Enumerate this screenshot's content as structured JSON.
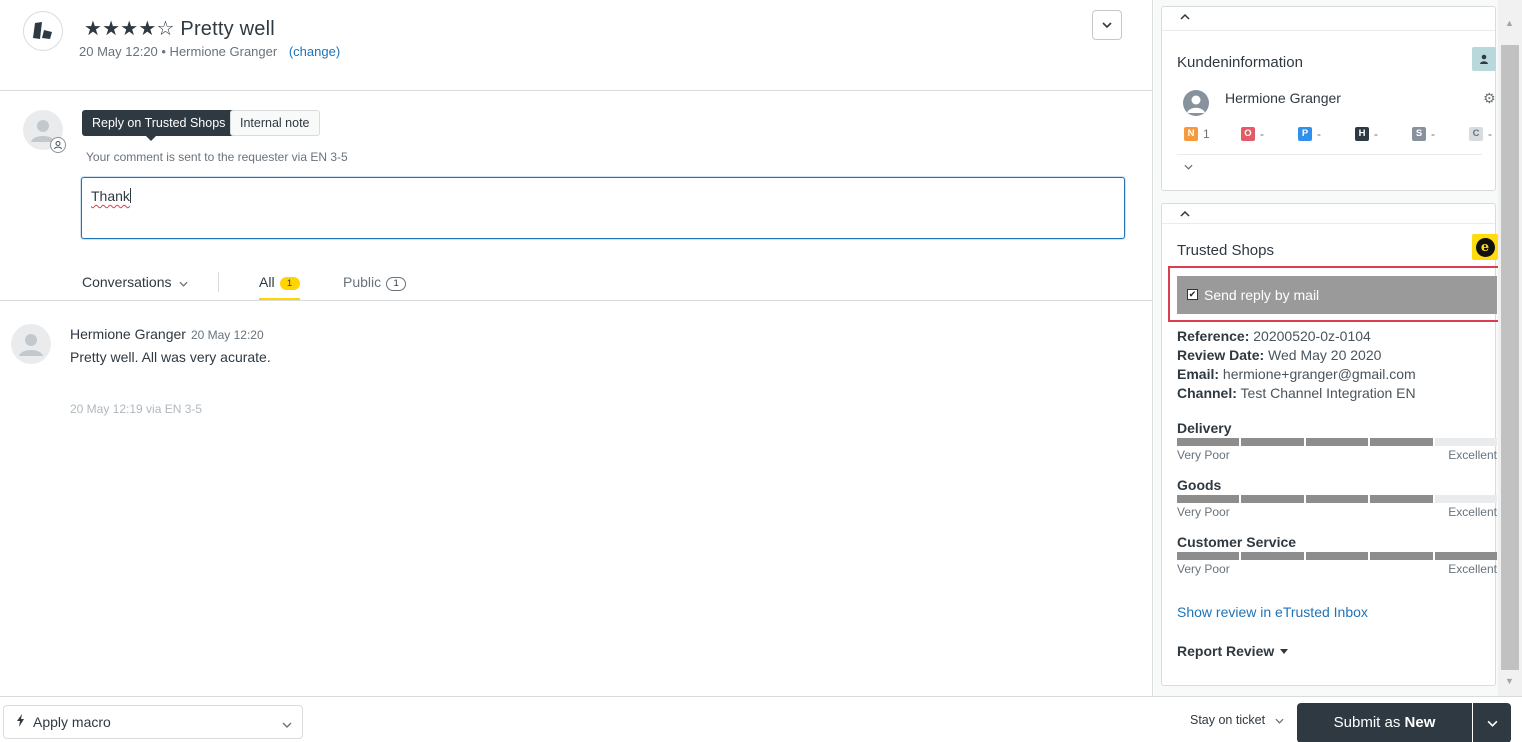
{
  "header": {
    "title": "★★★★☆ Pretty well",
    "meta": "20 May 12:20 • Hermione Granger",
    "change_link": "(change)"
  },
  "composer": {
    "tab_reply": "Reply on Trusted Shops",
    "tab_note": "Internal note",
    "hint": "Your comment is sent to the requester via EN 3-5",
    "text": "Thank"
  },
  "filters": {
    "conversations": "Conversations",
    "all": "All",
    "all_count": "1",
    "public": "Public",
    "public_count": "1"
  },
  "comment": {
    "author": "Hermione Granger",
    "time": "20 May 12:20",
    "body": "Pretty well. All was very acurate.",
    "via": "20 May 12:19 via EN 3-5"
  },
  "customer_info": {
    "title": "Kundeninformation",
    "name": "Hermione Granger",
    "stats": [
      {
        "tag": "N",
        "value": "1",
        "color": "#f79a3e"
      },
      {
        "tag": "O",
        "value": "-",
        "color": "#e35b66"
      },
      {
        "tag": "P",
        "value": "-",
        "color": "#3091ec"
      },
      {
        "tag": "H",
        "value": "-",
        "color": "#2f3941"
      },
      {
        "tag": "S",
        "value": "-",
        "color": "#87929d"
      },
      {
        "tag": "C",
        "value": "-",
        "color": "#d8dcde"
      }
    ]
  },
  "trusted_shops": {
    "title": "Trusted Shops",
    "send_reply_label": "Send reply by mail",
    "send_reply_checked": true,
    "fields": [
      {
        "label": "Reference:",
        "value": "20200520-0z-0104"
      },
      {
        "label": "Review Date:",
        "value": "Wed May 20 2020"
      },
      {
        "label": "Email:",
        "value": "hermione+granger@gmail.com"
      },
      {
        "label": "Channel:",
        "value": "Test Channel Integration EN"
      }
    ],
    "ratings": [
      {
        "label": "Delivery",
        "score": 4,
        "max": 5,
        "low": "Very Poor",
        "high": "Excellent"
      },
      {
        "label": "Goods",
        "score": 4,
        "max": 5,
        "low": "Very Poor",
        "high": "Excellent"
      },
      {
        "label": "Customer Service",
        "score": 5,
        "max": 5,
        "low": "Very Poor",
        "high": "Excellent"
      }
    ],
    "inbox_link": "Show review in eTrusted Inbox",
    "report_review": "Report Review"
  },
  "bottom_bar": {
    "apply_macro": "Apply macro",
    "stay_on_ticket": "Stay on ticket",
    "submit_prefix": "Submit as ",
    "submit_status": "New"
  },
  "colors": {
    "accent_blue": "#1f73b7",
    "brand_yellow": "#ffd400",
    "dark": "#2f3941",
    "highlight_red": "#d93f4c"
  }
}
